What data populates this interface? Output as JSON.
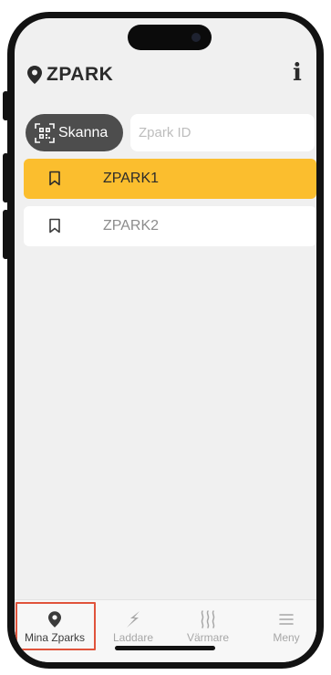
{
  "app": {
    "title": "ZPARK"
  },
  "search": {
    "scan_label": "Skanna",
    "placeholder": "Zpark ID",
    "value": ""
  },
  "zparks": [
    {
      "label": "ZPARK1",
      "selected": true
    },
    {
      "label": "ZPARK2",
      "selected": false
    }
  ],
  "tabs": [
    {
      "label": "Mina Zparks",
      "icon": "map-pin-icon",
      "active": true
    },
    {
      "label": "Laddare",
      "icon": "lightning-icon",
      "active": false
    },
    {
      "label": "Värmare",
      "icon": "heat-waves-icon",
      "active": false
    },
    {
      "label": "Meny",
      "icon": "hamburger-menu-icon",
      "active": false
    }
  ],
  "colors": {
    "accent": "#fbbe2e",
    "scan_button": "#4d4d4d",
    "background": "#f0f0f0",
    "highlight": "#e0533b"
  }
}
